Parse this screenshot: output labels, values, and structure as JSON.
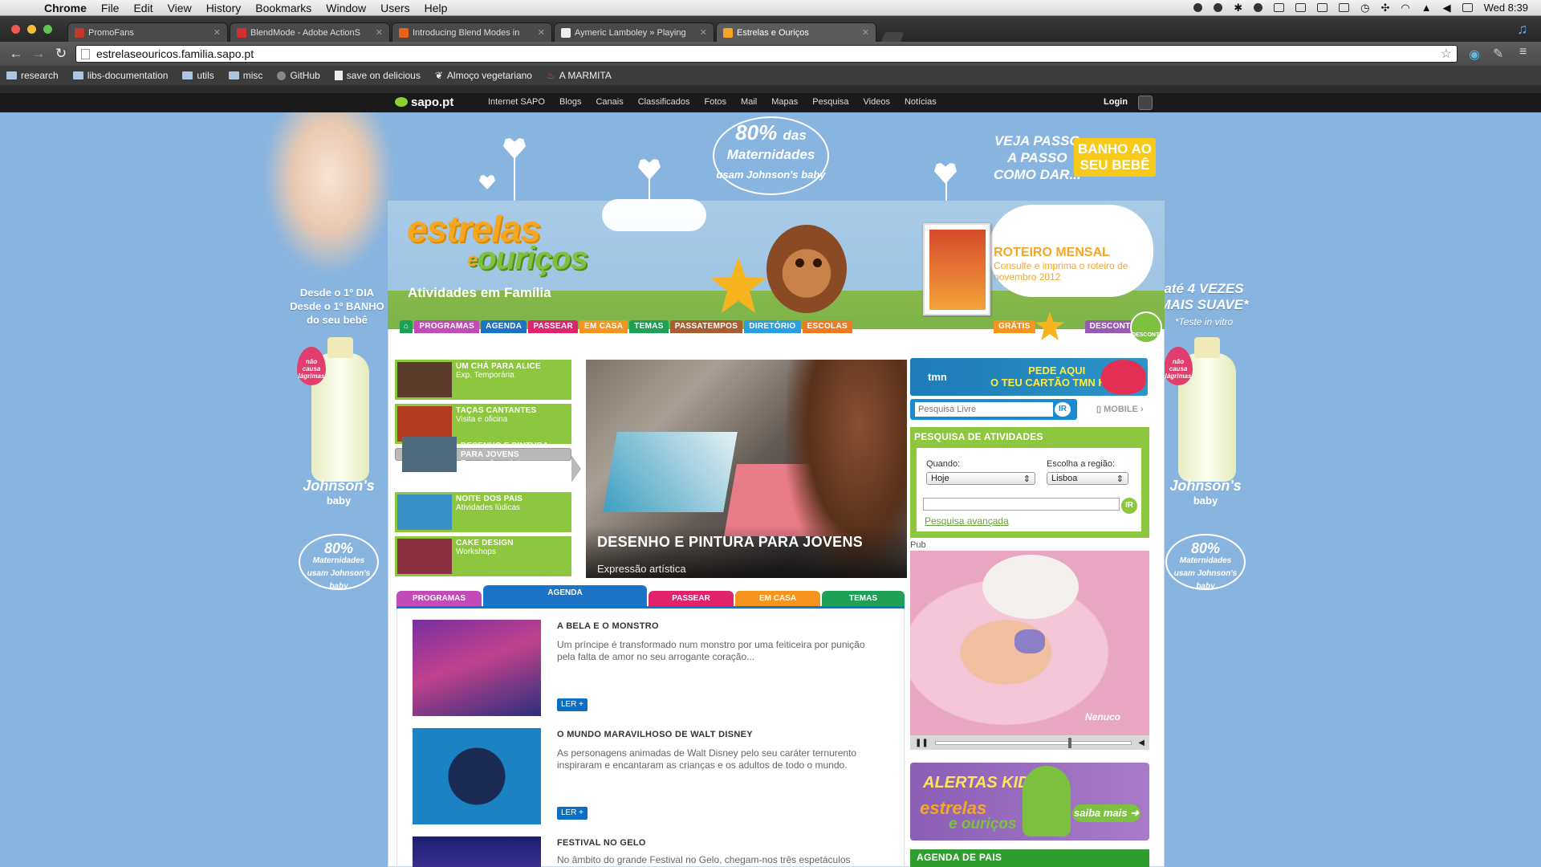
{
  "menubar": {
    "app": "Chrome",
    "items": [
      "File",
      "Edit",
      "View",
      "History",
      "Bookmarks",
      "Window",
      "Users",
      "Help"
    ],
    "clock": "Wed 8:39"
  },
  "tabs": [
    {
      "title": "PromoFans",
      "color": "#c0392b"
    },
    {
      "title": "BlendMode - Adobe ActionS",
      "color": "#d32f2f"
    },
    {
      "title": "Introducing Blend Modes in",
      "color": "#e8601c"
    },
    {
      "title": "Aymeric Lamboley » Playing",
      "color": "#eeeeee"
    },
    {
      "title": "Estrelas e Ouriços",
      "color": "#f5a623",
      "active": true
    }
  ],
  "address": "estrelaseouricos.familia.sapo.pt",
  "bookmarks": [
    {
      "label": "research",
      "icon": "folder-icon"
    },
    {
      "label": "libs-documentation",
      "icon": "folder-icon"
    },
    {
      "label": "utils",
      "icon": "folder-icon"
    },
    {
      "label": "misc",
      "icon": "folder-icon"
    },
    {
      "label": "GitHub",
      "icon": "github-icon"
    },
    {
      "label": "save on delicious",
      "icon": "page-icon"
    },
    {
      "label": "Almoço vegetariano",
      "icon": "leaf-icon"
    },
    {
      "label": "A MARMITA",
      "icon": "marmita-icon"
    }
  ],
  "sapo": {
    "logo": "sapo.pt",
    "links": [
      "Internet SAPO",
      "Blogs",
      "Canais",
      "Classificados",
      "Fotos",
      "Mail",
      "Mapas",
      "Pesquisa",
      "Videos",
      "Notícias"
    ],
    "login": "Login"
  },
  "ad": {
    "left_text": "Desde o 1º DIA\nDesde o 1º BANHO\ndo seu bebê",
    "tear": "não causa lágrimas",
    "brand": "Johnson's",
    "brand_sub": "baby",
    "mat_big": "80%",
    "mat_small": "das",
    "mat_line": "Maternidades",
    "mat_usam": "usam Johnson's baby",
    "veja": "VEJA PASSO\nA PASSO\nCOMO DAR...",
    "banho": "BANHO AO\nSEU BEBÊ",
    "right_text": "até 4 VEZES\nMAIS SUAVE*",
    "right_note": "*Teste in vitro"
  },
  "site": {
    "logo_1": "estrelas",
    "logo_e": "e",
    "logo_2": "ouriços",
    "tagline": "Atividades em Família",
    "roteiro_title": "ROTEIRO MENSAL",
    "roteiro_text": "Consulte e imprima o roteiro de novembro 2012",
    "nav": [
      {
        "label": "PROGRAMAS",
        "color": "#c24bb8"
      },
      {
        "label": "AGENDA",
        "color": "#1a73c6"
      },
      {
        "label": "PASSEAR",
        "color": "#e0236b"
      },
      {
        "label": "EM CASA",
        "color": "#f7941d"
      },
      {
        "label": "TEMAS",
        "color": "#1ea056"
      },
      {
        "label": "PASSATEMPOS",
        "color": "#a85c32"
      },
      {
        "label": "DIRETÓRIO",
        "color": "#2a9ee0"
      },
      {
        "label": "ESCOLAS",
        "color": "#f07a24"
      }
    ],
    "nav_right": [
      {
        "label": "GRÁTIS",
        "color": "#f7941d"
      },
      {
        "label": "DESCONTOS",
        "color": "#9b59b6"
      }
    ],
    "gratis_badge": "GRÁTIS",
    "desconto_badge": "DESCONTO"
  },
  "featured": [
    {
      "title": "UM CHÁ PARA ALICE",
      "sub": "Exp. Temporária",
      "color": "#5a3a2a"
    },
    {
      "title": "TAÇAS CANTANTES",
      "sub": "Visita e oficina",
      "color": "#b33b1f"
    },
    {
      "title": "DESENHO E PINTURA PARA JOVENS",
      "sub": "Expressão artística",
      "color": "#4e6b7d",
      "selected": true
    },
    {
      "title": "NOITE DOS PAIS",
      "sub": "Atividades lúdicas",
      "color": "#3a8fc6"
    },
    {
      "title": "CAKE DESIGN",
      "sub": "Workshops",
      "color": "#8a3040"
    }
  ],
  "hero": {
    "title": "DESENHO E PINTURA PARA JOVENS",
    "sub": "Expressão artística"
  },
  "content_tabs": [
    {
      "label": "PROGRAMAS",
      "color": "#c24bb8"
    },
    {
      "label": "AGENDA",
      "color": "#1a73c6",
      "active": true
    },
    {
      "label": "PASSEAR",
      "color": "#e0236b"
    },
    {
      "label": "EM CASA",
      "color": "#f7941d"
    },
    {
      "label": "TEMAS",
      "color": "#1ea056"
    }
  ],
  "articles": [
    {
      "title": "A BELA E O MONSTRO",
      "desc": "Um príncipe é transformado num monstro por uma feiticeira por punição pela falta de amor no seu arrogante coração...",
      "button": "LER +",
      "img": "linear-gradient(160deg,#7a2fa0,#c0418d 45%,#2b2f7d)"
    },
    {
      "title": "O MUNDO MARAVILHOSO DE WALT DISNEY",
      "desc": "As personagens animadas de Walt Disney pelo seu caráter ternurento inspiraram e encantaram as crianças e os adultos de todo o mundo.",
      "button": "LER +",
      "img": "radial-gradient(circle at 50% 50%,#1b2a52 0 35%,#1b82c4 36%)"
    },
    {
      "title": "FESTIVAL NO GELO",
      "desc": "No âmbito do grande Festival no Gelo, chegam-nos três espetáculos",
      "button": "",
      "img": "linear-gradient(#1a1f6e,#3a2f8e)"
    }
  ],
  "sidebar": {
    "tmn_logo": "tmn",
    "tmn_text": "PEDE AQUI\nO TEU CARTÃO TMN KIDS",
    "search_placeholder": "Pesquisa Livre",
    "search_button": "IR",
    "mobile": "MOBILE ›",
    "pesq_title": "PESQUISA DE ATIVIDADES",
    "quando_label": "Quando:",
    "quando_value": "Hoje",
    "regiao_label": "Escolha a região:",
    "regiao_value": "Lisboa",
    "pesq_button": "IR",
    "advanced": "Pesquisa avançada",
    "pub": "Pub",
    "video_brand": "Nenuco",
    "video_progress": 0.68,
    "alertas_title": "ALERTAS KIDS",
    "alertas_l1": "estrelas",
    "alertas_l2": "e ouriços",
    "alertas_button": "saiba mais ➜",
    "agenda_pais": "AGENDA DE PAIS"
  }
}
